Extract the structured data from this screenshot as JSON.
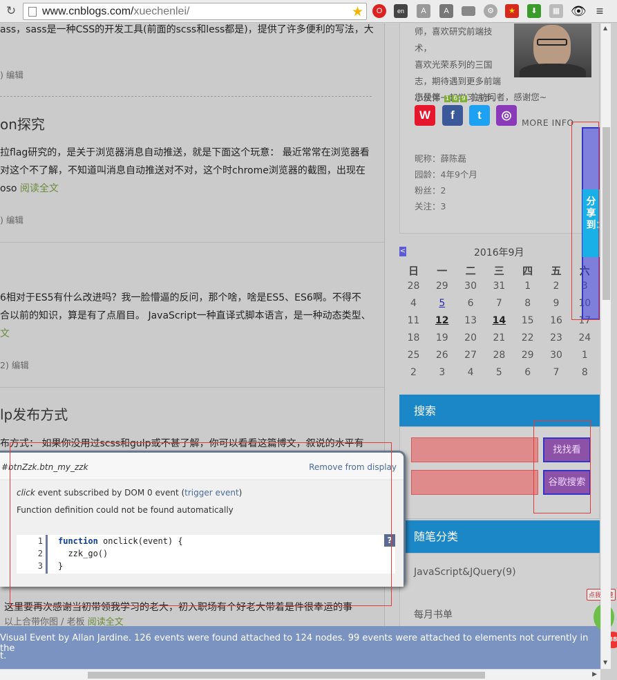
{
  "browser": {
    "url_host": "www.cnblogs.com/",
    "url_path": "xuechenlei/",
    "extensions": [
      "opera-icon",
      "translate-icon",
      "angular-icon",
      "angular-alt-icon",
      "folder-icon",
      "gear-icon",
      "china-flag-icon",
      "download-icon",
      "grid-icon",
      "eye-icon",
      "menu-icon"
    ]
  },
  "posts": [
    {
      "excerpt_lines": [
        "ass，sass是一种CSS的开发工具(前面的scss和less都是)，提供了许多便利的写法，大"
      ],
      "meta": ") 编辑"
    },
    {
      "title": "on探究",
      "excerpt_lines": [
        "拉flag研究的，是关于浏览器消息自动推送，就是下面这个玩意： 最近常常在浏览器看",
        "对这个不了解，不知道叫消息自动推送对不对，这个时chrome浏览器的截图，出现在"
      ],
      "excerpt_tail": "oso",
      "read_more": "阅读全文",
      "meta": ") 编辑"
    },
    {
      "excerpt_lines": [
        "6相对于ES5有什么改进吗？我一脸懵逼的反问，那个啥，啥是ES5、ES6啊。不得不",
        "合以前的知识，算是有了点眉目。 JavaScript一种直译式脚本语言，是一种动态类型、"
      ],
      "read_more": "文",
      "meta": "2) 编辑"
    },
    {
      "title": "lp发布方式",
      "excerpt_lines": [
        "布方式： 如果你没用过scss和gulp或不甚了解，你可以看看这篇博文，叙说的水平有"
      ]
    }
  ],
  "hidden_post": {
    "line1": "这里要再次感谢当初带领我学习的老大，初入职场有个好老大带着是件很幸运的事",
    "line2": "以上合带你图 / 老板",
    "read_more": "阅读全文"
  },
  "sidebar": {
    "profile_lines": [
      "师，喜欢研究前端技术，",
      "喜欢光荣系列的三国",
      "志，期待遇到更多前端",
      "小伙伴一起学习进步。"
    ],
    "visitor_prefix": "您是第",
    "visitor_digits": [
      "1",
      "6",
      "9"
    ],
    "visitor_suffix": "位访问者，感谢您~",
    "social": [
      {
        "name": "weibo-icon",
        "glyph": "W",
        "color": "#e6162d"
      },
      {
        "name": "facebook-icon",
        "glyph": "f",
        "color": "#3b5998"
      },
      {
        "name": "twitter-icon",
        "glyph": "t",
        "color": "#1da1f2"
      },
      {
        "name": "instagram-icon",
        "glyph": "◎",
        "color": "#8a3ab9"
      }
    ],
    "more_info": "MORE INFO",
    "info": {
      "nickname": "昵称：薛陈磊",
      "age": "园龄：4年9个月",
      "fans": "粉丝：2",
      "follow": "关注：3"
    },
    "share_label": "分享到：",
    "calendar": {
      "prev": "<",
      "title": "2016年9月",
      "weekdays": [
        "日",
        "一",
        "二",
        "三",
        "四",
        "五",
        "六"
      ],
      "weeks": [
        [
          "28",
          "29",
          "30",
          "31",
          "1",
          "2",
          "3"
        ],
        [
          "4",
          "5",
          "6",
          "7",
          "8",
          "9",
          "10"
        ],
        [
          "11",
          "12",
          "13",
          "14",
          "15",
          "16",
          "17"
        ],
        [
          "18",
          "19",
          "20",
          "21",
          "22",
          "23",
          "24"
        ],
        [
          "25",
          "26",
          "27",
          "28",
          "29",
          "30",
          "1"
        ],
        [
          "2",
          "3",
          "4",
          "5",
          "6",
          "7",
          "8"
        ]
      ],
      "linked_days": [
        "5"
      ],
      "bold_days": [
        "12",
        "14"
      ]
    },
    "search": {
      "title": "搜索",
      "btn_find": "找找看",
      "btn_google": "谷歌搜索",
      "input1_value": "",
      "input2_value": ""
    },
    "categories": {
      "title": "随笔分类",
      "items": [
        "JavaScript&JQuery(9)"
      ]
    },
    "monthly": {
      "title": "每月书单"
    }
  },
  "visual_event": {
    "node": "#btnZzk.btn_my_zzk",
    "remove": "Remove from display",
    "event_type": "click",
    "event_desc": " event subscribed by DOM 0 event (",
    "trigger": "trigger event",
    "event_close": ")",
    "not_found": "Function definition could not be found automatically",
    "code_lines": [
      "function onclick(event) {",
      "  zzk_go()",
      "}"
    ],
    "help": "?",
    "bar_line1": "Visual Event by Allan Jardine.  126 events were found attached to 124 nodes. 99 events were attached to elements not currently in the",
    "bar_line2": "t."
  },
  "speed_widget": {
    "badge": "点我加速",
    "count": "88"
  }
}
